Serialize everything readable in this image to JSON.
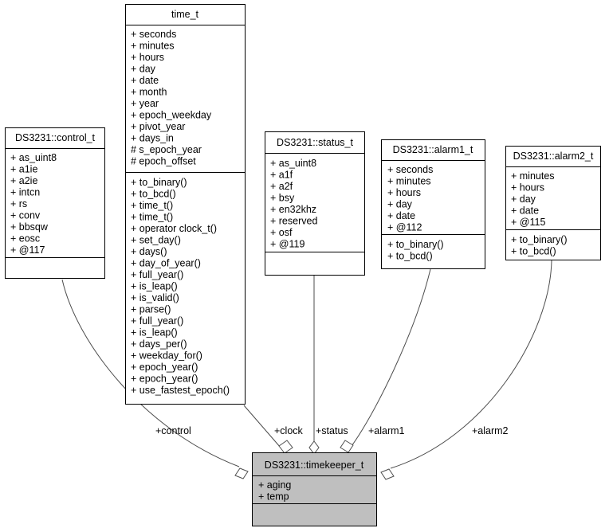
{
  "diagram": {
    "type": "uml-collaboration-diagram",
    "background_color": "#ffffff",
    "line_color": "#4d4d4d",
    "highlight_fill": "#bfbfbf",
    "box_fill": "#ffffff",
    "border_color": "#000000"
  },
  "classes": {
    "time_t": {
      "name": "time_t",
      "attributes": [
        "+ seconds",
        "+ minutes",
        "+ hours",
        "+ day",
        "+ date",
        "+ month",
        "+ year",
        "+ epoch_weekday",
        "+ pivot_year",
        "+ days_in",
        "# s_epoch_year",
        "# epoch_offset"
      ],
      "methods": [
        "+ to_binary()",
        "+ to_bcd()",
        "+ time_t()",
        "+ time_t()",
        "+ operator clock_t()",
        "+ set_day()",
        "+ days()",
        "+ day_of_year()",
        "+ full_year()",
        "+ is_leap()",
        "+ is_valid()",
        "+ parse()",
        "+ full_year()",
        "+ is_leap()",
        "+ days_per()",
        "+ weekday_for()",
        "+ epoch_year()",
        "+ epoch_year()",
        "+ use_fastest_epoch()"
      ]
    },
    "control_t": {
      "name": "DS3231::control_t",
      "attributes": [
        "+ as_uint8",
        "+ a1ie",
        "+ a2ie",
        "+ intcn",
        "+ rs",
        "+ conv",
        "+ bbsqw",
        "+ eosc",
        "+ @117"
      ],
      "methods": []
    },
    "status_t": {
      "name": "DS3231::status_t",
      "attributes": [
        "+ as_uint8",
        "+ a1f",
        "+ a2f",
        "+ bsy",
        "+ en32khz",
        "+ reserved",
        "+ osf",
        "+ @119"
      ],
      "methods": []
    },
    "alarm1_t": {
      "name": "DS3231::alarm1_t",
      "attributes": [
        "+ seconds",
        "+ minutes",
        "+ hours",
        "+ day",
        "+ date",
        "+ @112"
      ],
      "methods": [
        "+ to_binary()",
        "+ to_bcd()"
      ]
    },
    "alarm2_t": {
      "name": "DS3231::alarm2_t",
      "attributes": [
        "+ minutes",
        "+ hours",
        "+ day",
        "+ date",
        "+ @115"
      ],
      "methods": [
        "+ to_binary()",
        "+ to_bcd()"
      ]
    },
    "timekeeper_t": {
      "name": "DS3231::timekeeper_t",
      "attributes": [
        "+ aging",
        "+ temp"
      ],
      "methods": []
    }
  },
  "relations": [
    {
      "id": "control",
      "label": "+control",
      "from": "control_t",
      "to": "timekeeper_t"
    },
    {
      "id": "clock",
      "label": "+clock",
      "from": "time_t",
      "to": "timekeeper_t"
    },
    {
      "id": "status",
      "label": "+status",
      "from": "status_t",
      "to": "timekeeper_t"
    },
    {
      "id": "alarm1",
      "label": "+alarm1",
      "from": "alarm1_t",
      "to": "timekeeper_t"
    },
    {
      "id": "alarm2",
      "label": "+alarm2",
      "from": "alarm2_t",
      "to": "timekeeper_t"
    }
  ]
}
